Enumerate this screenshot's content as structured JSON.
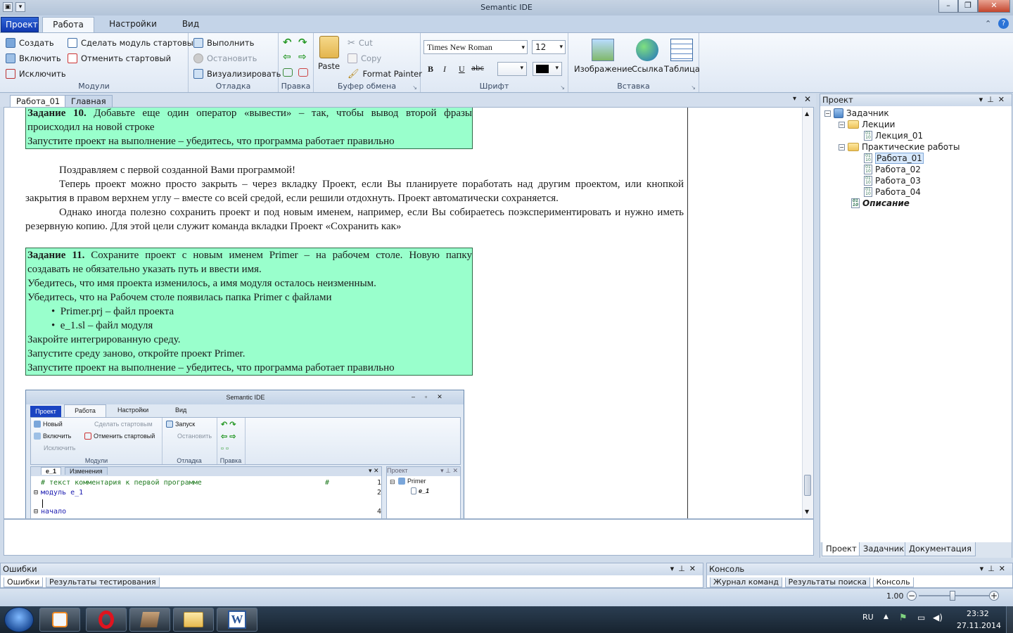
{
  "window": {
    "title": "Semantic IDE"
  },
  "tabs": {
    "proj": "Проект",
    "work": "Работа",
    "settings": "Настройки",
    "view": "Вид"
  },
  "ribbon": {
    "modules": {
      "create": "Создать",
      "include": "Включить",
      "exclude": "Исключить",
      "make_start": "Сделать модуль стартовым",
      "unset_start": "Отменить стартовый",
      "label": "Модули"
    },
    "debug": {
      "run": "Выполнить",
      "stop": "Остановить",
      "visualize": "Визуализировать",
      "label": "Отладка"
    },
    "edit": {
      "label": "Правка"
    },
    "clipboard": {
      "paste": "Paste",
      "cut": "Cut",
      "copy": "Copy",
      "format_painter": "Format Painter",
      "label": "Буфер обмена"
    },
    "font": {
      "family": "Times New Roman",
      "size": "12",
      "bold": "B",
      "italic": "I",
      "underline": "U",
      "strike": "abc",
      "label": "Шрифт"
    },
    "insert": {
      "image": "Изображение",
      "link": "Ссылка",
      "table": "Таблица",
      "label": "Вставка"
    }
  },
  "doc_tabs": [
    "Работа_01",
    "Главная"
  ],
  "document": {
    "task10_line1_bold": "Задание 10.",
    "task10_line1": " Добавьте еще один оператор «вывести» – так, чтобы вывод второй фразы",
    "task10_line2": "происходил на новой строке",
    "task10_line3": "Запустите проект на выполнение – убедитесь, что программа работает правильно",
    "p1": "Поздравляем с первой созданной Вами программой!",
    "p2": "Теперь проект можно просто закрыть – через вкладку Проект, если Вы планируете поработать над другим проектом, или кнопкой закрытия в правом верхнем углу – вместе со всей средой, если решили отдохнуть. Проект автоматически сохраняется.",
    "p3": "Однако иногда полезно сохранить проект и под новым именем, например, если Вы собираетесь поэкспериментировать и нужно иметь резервную копию. Для этой цели служит команда вкладки Проект «Сохранить как»",
    "task11_bold": "Задание 11.",
    "task11_l1": " Сохраните проект с новым именем Primer – на рабочем столе. Новую папку",
    "task11_l2": "создавать не обязательно указать путь и ввести имя.",
    "task11_l3": "Убедитесь, что имя проекта изменилось, а имя модуля осталось неизменным.",
    "task11_l4": "Убедитесь, что на Рабочем столе появилась папка Primer с файлами",
    "task11_b1": "Primer.prj – файл проекта",
    "task11_b2": "e_1.sl – файл модуля",
    "task11_l5": "Закройте интегрированную среду.",
    "task11_l6": "Запустите среду заново, откройте проект Primer.",
    "task11_l7": "Запустите проект на выполнение – убедитесь, что программа работает правильно"
  },
  "mini": {
    "title": "Semantic IDE",
    "tabs": [
      "Проект",
      "Работа",
      "Настройки",
      "Вид"
    ],
    "new": "Новый",
    "include": "Включить",
    "exclude": "Исключить",
    "make_start": "Сделать стартовым",
    "unset_start": "Отменить стартовый",
    "launch": "Запуск",
    "stop": "Остановить",
    "modules": "Модули",
    "debug": "Отладка",
    "edit": "Правка",
    "doc_tabs": [
      "e_1",
      "Изменения"
    ],
    "code": [
      {
        "n": "1",
        "t": "# текст комментария к первой программе",
        "hash": "#"
      },
      {
        "n": "2",
        "t": "модуль e_1"
      },
      {
        "n": "4",
        "t": "начало"
      }
    ],
    "project": "Проект",
    "root": "Primer",
    "file": "e_1"
  },
  "project_panel": {
    "title": "Проект",
    "root": "Задачник",
    "lectures": "Лекции",
    "lecture1": "Лекция_01",
    "practice": "Практические работы",
    "works": [
      "Работа_01",
      "Работа_02",
      "Работа_03",
      "Работа_04"
    ],
    "description": "Описание",
    "bottom_tabs": [
      "Проект",
      "Задачник",
      "Документация"
    ]
  },
  "errors_panel": {
    "title": "Ошибки",
    "tabs": [
      "Ошибки",
      "Результаты тестирования"
    ]
  },
  "console_panel": {
    "title": "Консоль",
    "tabs": [
      "Журнал команд",
      "Результаты поиска",
      "Консоль"
    ]
  },
  "status": {
    "zoom": "1.00"
  },
  "tray": {
    "lang": "RU",
    "time": "23:32",
    "date": "27.11.2014"
  },
  "colors": {
    "task_box": "#99ffcc",
    "ribbon_bg": "#dfe8f4",
    "proj_tab": "#1a44c2"
  }
}
